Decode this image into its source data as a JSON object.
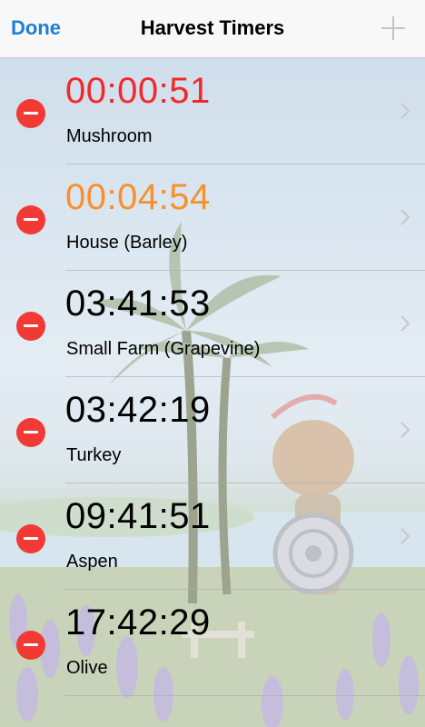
{
  "nav": {
    "done_label": "Done",
    "title": "Harvest Timers",
    "add_icon": "plus-icon"
  },
  "colors": {
    "accent": "#1b7fd6",
    "delete": "#f23a35",
    "timer_urgent": "#f2282c",
    "timer_soon": "#f7902d"
  },
  "timers": [
    {
      "time": "00:00:51",
      "name": "Mushroom",
      "status": "urgent"
    },
    {
      "time": "00:04:54",
      "name": "House (Barley)",
      "status": "soon"
    },
    {
      "time": "03:41:53",
      "name": "Small Farm (Grapevine)",
      "status": "normal"
    },
    {
      "time": "03:42:19",
      "name": "Turkey",
      "status": "normal"
    },
    {
      "time": "09:41:51",
      "name": "Aspen",
      "status": "normal"
    },
    {
      "time": "17:42:29",
      "name": "Olive",
      "status": "normal"
    }
  ]
}
